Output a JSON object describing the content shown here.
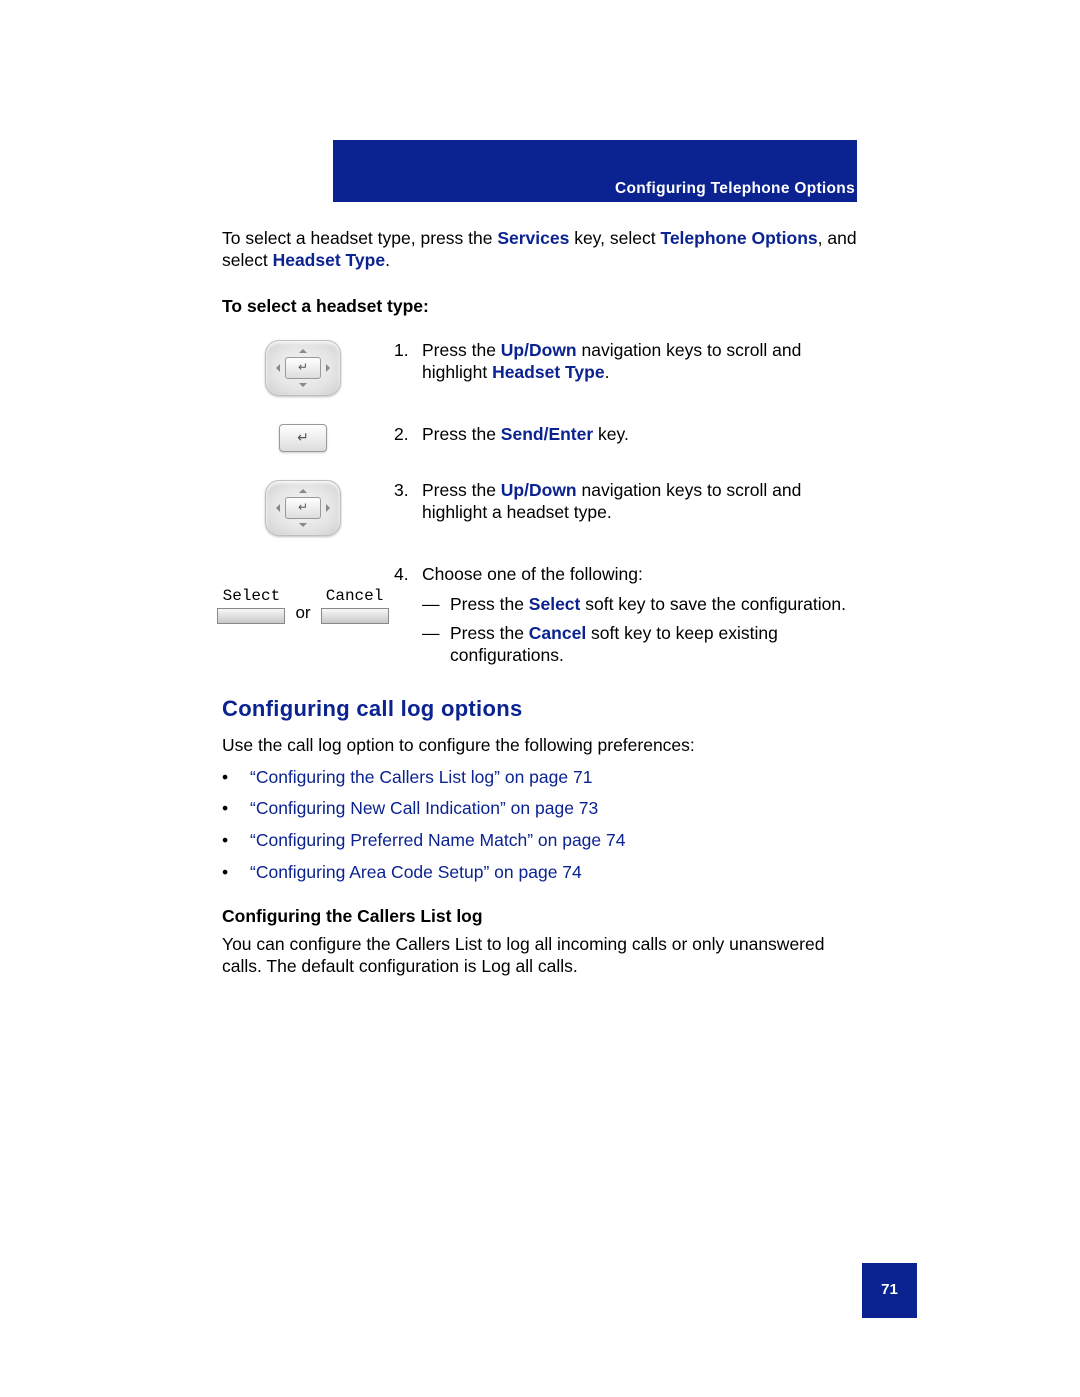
{
  "header": {
    "section_title": "Configuring Telephone Options"
  },
  "intro": {
    "p1a": "To select a headset type, press the ",
    "services": "Services",
    "p1b": " key, select ",
    "telopts": "Telephone Options",
    "p1c": ", and select ",
    "headset_type": "Headset Type",
    "p1d": "."
  },
  "subhead1": "To select a headset type:",
  "step1": {
    "num": "1.",
    "a": "Press the ",
    "updown": "Up/Down",
    "b": " navigation keys to scroll and highlight ",
    "ht": "Headset Type",
    "c": "."
  },
  "step2": {
    "num": "2.",
    "a": "Press the ",
    "sendenter": "Send/Enter",
    "b": " key."
  },
  "step3": {
    "num": "3.",
    "a": "Press the ",
    "updown": "Up/Down",
    "b": " navigation keys to scroll and highlight a headset type."
  },
  "step4": {
    "num": "4.",
    "lead": "Choose one of the following:",
    "d1a": "Press the ",
    "select": "Select",
    "d1b": " soft key to save the configuration.",
    "d2a": "Press the ",
    "cancel": "Cancel",
    "d2b": " soft key to keep existing configurations."
  },
  "softkeys": {
    "select_label": "Select",
    "cancel_label": "Cancel",
    "or": "or"
  },
  "h2": "Configuring call log options",
  "h2_desc": "Use the call log option to configure the following preferences:",
  "links": {
    "l1": "“Configuring the Callers List log” on page 71",
    "l2": "“Configuring New Call Indication” on page 73",
    "l3": "“Configuring Preferred Name Match” on page 74",
    "l4": "“Configuring Area Code Setup” on page 74"
  },
  "subhead2": "Configuring the Callers List log",
  "para2": "You can configure the Callers List to log all incoming calls or only unanswered calls. The default configuration is Log all calls.",
  "page_number": "71",
  "glyphs": {
    "enter": "↵",
    "bullet": "•",
    "dash": "—"
  }
}
